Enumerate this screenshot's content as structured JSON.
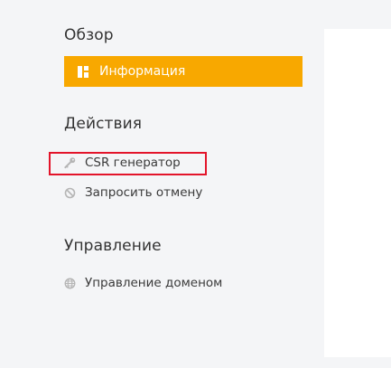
{
  "sidebar": {
    "overview_title": "Обзор",
    "info_item": {
      "label": "Информация",
      "icon": "layout-icon",
      "active": true
    },
    "actions_title": "Действия",
    "actions": [
      {
        "label": "CSR генератор",
        "icon": "key-icon"
      },
      {
        "label": "Запросить отмену",
        "icon": "ban-icon"
      }
    ],
    "management_title": "Управление",
    "management": [
      {
        "label": "Управление доменом",
        "icon": "globe-icon"
      }
    ]
  },
  "colors": {
    "accent": "#f8a800",
    "highlight": "#e3142a",
    "background": "#f4f5f7"
  }
}
